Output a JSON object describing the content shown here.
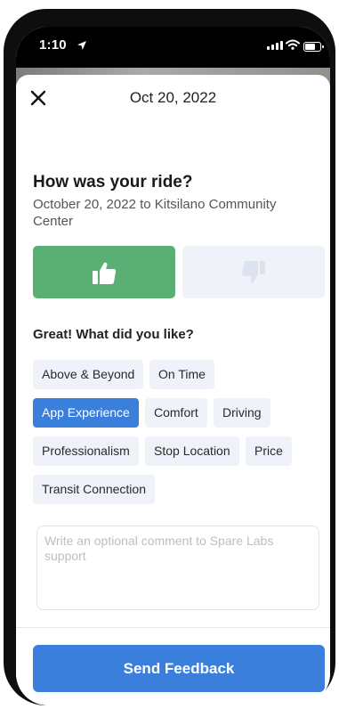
{
  "status_bar": {
    "time": "1:10",
    "icons": [
      "location-arrow-icon",
      "signal-icon",
      "wifi-icon",
      "battery-icon"
    ]
  },
  "header": {
    "title": "Oct 20, 2022",
    "close_icon": "close-icon"
  },
  "ride": {
    "question": "How was your ride?",
    "subtitle": "October 20, 2022 to Kitsilano Community Center"
  },
  "rating": {
    "up_icon": "thumbs-up-icon",
    "down_icon": "thumbs-down-icon",
    "selected": "up"
  },
  "likes": {
    "title": "Great! What did you like?",
    "chips": [
      {
        "label": "Above & Beyond",
        "selected": false
      },
      {
        "label": "On Time",
        "selected": false
      },
      {
        "label": "App Experience",
        "selected": true
      },
      {
        "label": "Comfort",
        "selected": false
      },
      {
        "label": "Driving",
        "selected": false
      },
      {
        "label": "Professionalism",
        "selected": false
      },
      {
        "label": "Stop Location",
        "selected": false
      },
      {
        "label": "Price",
        "selected": false
      },
      {
        "label": "Transit Connection",
        "selected": false
      }
    ]
  },
  "comment": {
    "placeholder": "Write an optional comment to Spare Labs support",
    "value": ""
  },
  "footer": {
    "send_label": "Send Feedback"
  },
  "colors": {
    "accent": "#3a7fdc",
    "positive": "#5ab074",
    "chip_bg": "#eff2f8"
  }
}
